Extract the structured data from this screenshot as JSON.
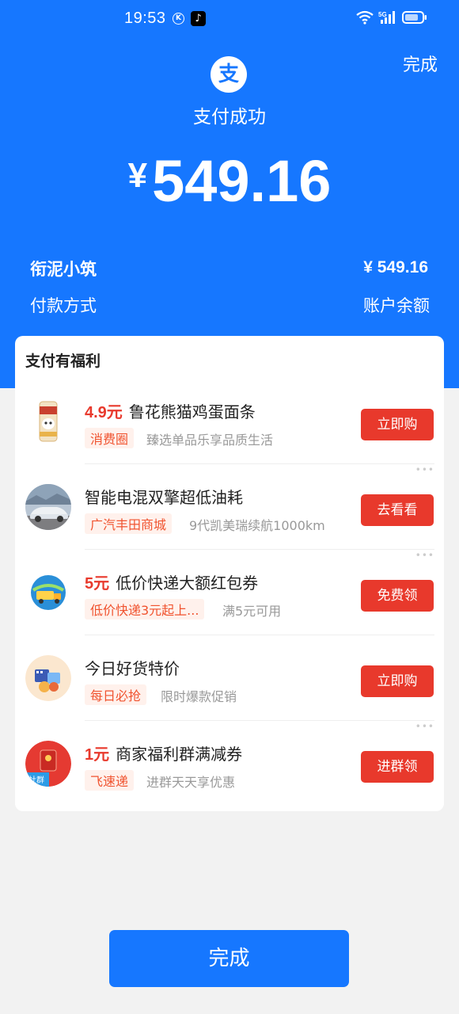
{
  "status_bar": {
    "time": "19:53",
    "k_badge": "K",
    "tiktok_glyph": "♪",
    "network": "5G"
  },
  "header": {
    "done_label": "完成",
    "logo_glyph": "支",
    "success_text": "支付成功",
    "currency_symbol": "¥",
    "amount": "549.16"
  },
  "order": {
    "merchant": "衔泥小筑",
    "paid_amount": "¥ 549.16",
    "pay_method_label": "付款方式",
    "pay_method_value": "账户余额"
  },
  "benefits": {
    "title": "支付有福利",
    "items": [
      {
        "price": "4.9元",
        "title": "鲁花熊猫鸡蛋面条",
        "tag": "消费圈",
        "desc": "臻选单品乐享品质生活",
        "button": "立即购",
        "icon": "noodle-package-icon"
      },
      {
        "price": "",
        "title": "智能电混双擎超低油耗",
        "tag": "广汽丰田商城",
        "desc": "9代凯美瑞续航1000km",
        "button": "去看看",
        "icon": "car-icon"
      },
      {
        "price": "5元",
        "title": "低价快递大额红包券",
        "tag": "低价快递3元起上...",
        "desc": "满5元可用",
        "button": "免费领",
        "icon": "express-delivery-icon"
      },
      {
        "price": "",
        "title": "今日好货特价",
        "tag": "每日必抢",
        "desc": "限时爆款促销",
        "button": "立即购",
        "icon": "daily-deals-icon"
      },
      {
        "price": "1元",
        "title": "商家福利群满减券",
        "tag": "飞速递",
        "desc": "进群天天享优惠",
        "button": "进群领",
        "icon": "red-envelope-icon",
        "icon_label": "社群"
      }
    ]
  },
  "footer": {
    "done_label": "完成"
  },
  "colors": {
    "brand_blue": "#1677ff",
    "accent_red": "#e8392c",
    "tag_bg": "#fff1ec"
  }
}
